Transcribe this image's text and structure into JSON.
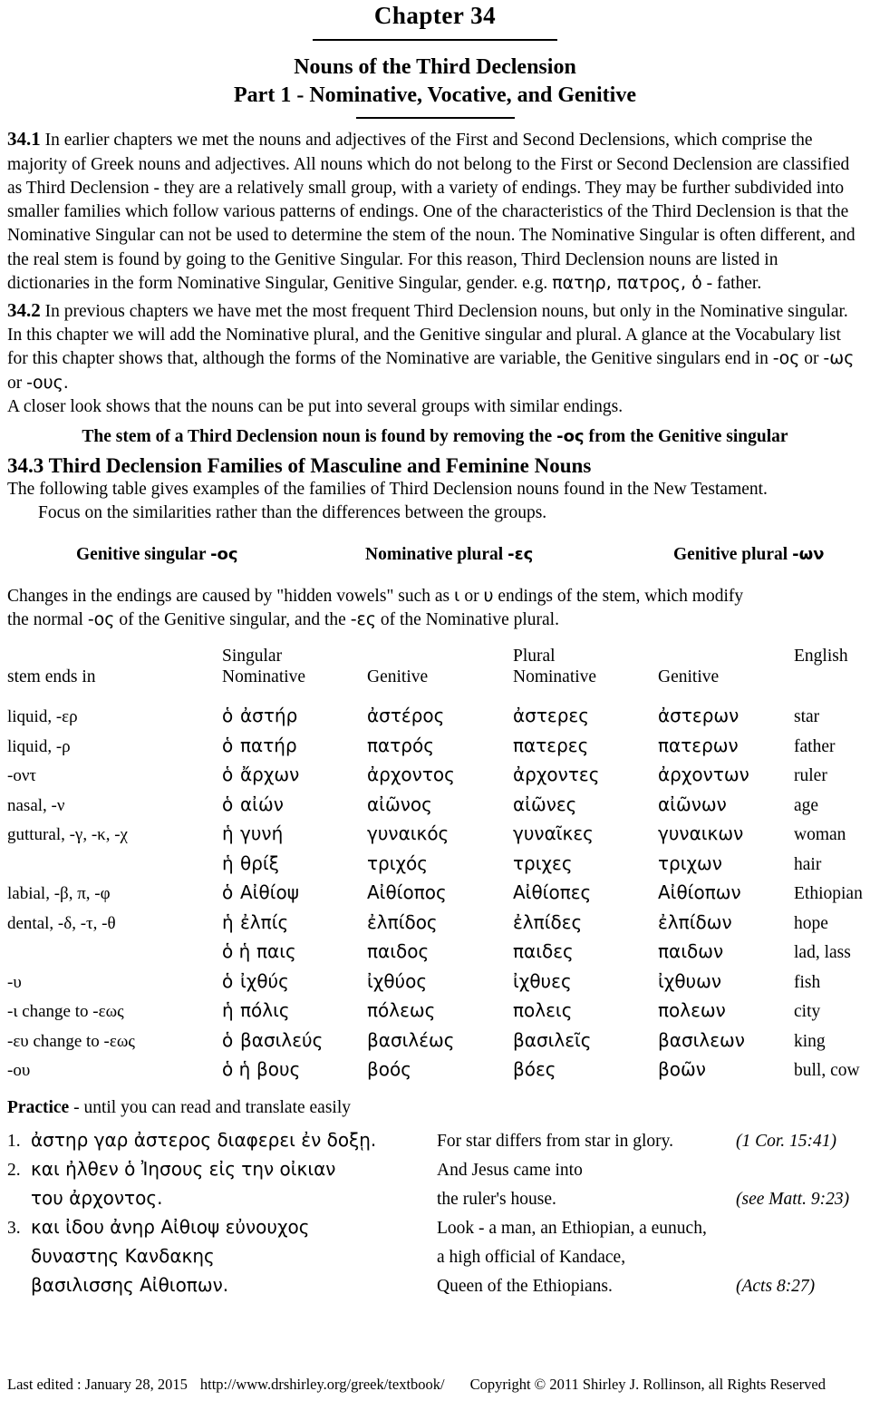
{
  "header": {
    "chapter_title": "Chapter  34",
    "subtitle_line1": "Nouns of the Third Declension",
    "subtitle_line2": "Part 1  -  Nominative, Vocative, and Genitive"
  },
  "sections": {
    "s341": {
      "number": "34.1",
      "text": "In earlier chapters we met the nouns and adjectives of the First and Second Declensions, which comprise the majority of Greek nouns and adjectives. All nouns which do not belong to the First or Second Declension are classified as Third Declension - they are a relatively small group, with a variety of endings. They may be further subdivided into smaller families which follow various patterns of endings. One of the characteristics of the Third Declension is that the Nominative Singular can not be used to determine the stem of the noun. The Nominative Singular is often different, and the real stem is found by going to the Genitive Singular. For this reason, Third Declension nouns are listed in dictionaries in the form Nominative Singular, Genitive Singular, gender.  e.g.",
      "example_greek": "πατηρ,  πατρος,  ὁ",
      "example_tail": "- father."
    },
    "s342": {
      "number": "34.2",
      "text_a": "In previous chapters we have met the most frequent Third Declension nouns, but only in the Nominative singular.  In this chapter we will add the Nominative plural, and the Genitive singular and plural. A glance at the Vocabulary list for this chapter shows that, although the forms of the Nominative are variable, the Genitive singulars end in",
      "ending_1": "-ος",
      "joiner_1": "or",
      "ending_2": "-ως",
      "joiner_2": "or",
      "ending_3": "-ους.",
      "text_b": "A closer look shows that the nouns can be put into several groups with similar endings.",
      "stem_rule_a": "The stem of a Third Declension noun is found by removing the",
      "stem_rule_ending": "-ος",
      "stem_rule_b": "from the Genitive singular"
    },
    "s343": {
      "number": "34.3",
      "heading": "Third Declension Families of Masculine and Feminine Nouns",
      "lead_1": "The following table gives examples of the families of Third Declension nouns found in the New Testament.",
      "lead_2": "Focus on the similarities rather than the differences between the groups.",
      "endings": [
        {
          "label": "Genitive singular",
          "ending": "-ος"
        },
        {
          "label": "Nominative plural",
          "ending": "-ες"
        },
        {
          "label": "Genitive plural",
          "ending": "-ων"
        }
      ],
      "note_a": "Changes in the endings are caused by \"hidden vowels\" such as",
      "note_vowel_1": "ι",
      "note_joiner": "or",
      "note_vowel_2": "υ",
      "note_b": "endings of the stem, which modify",
      "note_c": "the normal",
      "note_gen_ending": "-ος",
      "note_d": "of the Genitive singular, and the",
      "note_nom_ending": "-ες",
      "note_e": "of the Nominative plural."
    }
  },
  "table": {
    "group_headers": {
      "singular": "Singular",
      "plural": "Plural",
      "english": "English"
    },
    "columns": {
      "stem": "stem ends in",
      "nom_sing": "Nominative",
      "gen_sing": "Genitive",
      "nom_plur": "Nominative",
      "gen_plur": "Genitive",
      "english": ""
    },
    "rows": [
      {
        "stem": "liquid, -ερ",
        "article": "ὁ",
        "nom_s": "ἀστήρ",
        "gen_s": "ἀστέρος",
        "nom_p": "ἀστερες",
        "gen_p": "ἀστερων",
        "english": "star"
      },
      {
        "stem": "liquid, -ρ",
        "article": "ὁ",
        "nom_s": "πατήρ",
        "gen_s": "πατρός",
        "nom_p": "πατερες",
        "gen_p": "πατερων",
        "english": "father"
      },
      {
        "stem": "-οντ",
        "article": "ὁ",
        "nom_s": "ἄρχων",
        "gen_s": "ἀρχοντος",
        "nom_p": "ἀρχοντες",
        "gen_p": "ἀρχοντων",
        "english": "ruler"
      },
      {
        "stem": "nasal, -ν",
        "article": "ὁ",
        "nom_s": "αἰών",
        "gen_s": "αἰῶνος",
        "nom_p": "αἰῶνες",
        "gen_p": "αἰῶνων",
        "english": "age"
      },
      {
        "stem": "guttural,  -γ, -κ, -χ",
        "article": "ἡ",
        "nom_s": "γυνή",
        "gen_s": "γυναικός",
        "nom_p": "γυναῖκες",
        "gen_p": "γυναικων",
        "english": "woman"
      },
      {
        "stem": "",
        "article": "ἡ",
        "nom_s": "θρίξ",
        "gen_s": "τριχός",
        "nom_p": "τριχες",
        "gen_p": "τριχων",
        "english": "hair"
      },
      {
        "stem": "labial, -β, π, -φ",
        "article": "ὁ",
        "nom_s": "Αἰθίοψ",
        "gen_s": "Αἰθίοπος",
        "nom_p": "Αἰθίοπες",
        "gen_p": "Αἰθίοπων",
        "english": "Ethiopian"
      },
      {
        "stem": "dental, -δ, -τ, -θ",
        "article": "ἡ",
        "nom_s": "ἐλπίς",
        "gen_s": "ἐλπίδος",
        "nom_p": "ἐλπίδες",
        "gen_p": "ἐλπίδων",
        "english": "hope"
      },
      {
        "stem": "",
        "article": "ὁ ἡ",
        "nom_s": "παις",
        "gen_s": "παιδος",
        "nom_p": "παιδες",
        "gen_p": "παιδων",
        "english": "lad, lass"
      },
      {
        "stem": "-υ",
        "article": "ὁ",
        "nom_s": "ἰχθύς",
        "gen_s": "ἰχθύος",
        "nom_p": "ἰχθυες",
        "gen_p": "ἰχθυων",
        "english": "fish"
      },
      {
        "stem": "-ι change to -εως",
        "article": "ἡ",
        "nom_s": "πόλις",
        "gen_s": "πόλεως",
        "nom_p": "πολεις",
        "gen_p": "πολεων",
        "english": "city"
      },
      {
        "stem": "-ευ change to -εως",
        "article": "ὁ",
        "nom_s": "βασιλεύς",
        "gen_s": "βασιλέως",
        "nom_p": "βασιλεῖς",
        "gen_p": "βασιλεων",
        "english": "king"
      },
      {
        "stem": "-ου",
        "article": "ὁ ἡ",
        "nom_s": "βους",
        "gen_s": "βοός",
        "nom_p": "βόες",
        "gen_p": "βοῶν",
        "english": "bull, cow"
      }
    ]
  },
  "practice": {
    "title": "Practice",
    "subtitle": "- until you can read and translate easily",
    "items": [
      {
        "num": "1.",
        "greek": "ἀστηρ γαρ ἀστερος διαφερει ἐν δοξῃ.",
        "english": "For star differs from star in glory.",
        "ref": "(1 Cor. 15:41)"
      },
      {
        "num": "2.",
        "greek": "και ἠλθεν ὁ Ἰησους εἰς την οἰκιαν",
        "english": "And Jesus came into",
        "ref": ""
      },
      {
        "num": "",
        "greek": "του ἀρχοντος.",
        "english": "the ruler's house.",
        "ref": "(see Matt. 9:23)"
      },
      {
        "num": "3.",
        "greek": "και ἰδου ἀνηρ Αἰθιοψ εὐνουχος",
        "english": "Look - a man, an Ethiopian, a eunuch,",
        "ref": ""
      },
      {
        "num": "",
        "greek": "δυναστης Κανδακης",
        "english": "a high official of Kandace,",
        "ref": ""
      },
      {
        "num": "",
        "greek": "βασιλισσης Αἰθιοπων.",
        "english": "Queen of the Ethiopians.",
        "ref": "(Acts 8:27)"
      }
    ]
  },
  "footer": {
    "last_edited": "Last edited : January 28, 2015",
    "url": "http://www.drshirley.org/greek/textbook/",
    "copyright": "Copyright © 2011 Shirley J. Rollinson, all Rights Reserved"
  }
}
